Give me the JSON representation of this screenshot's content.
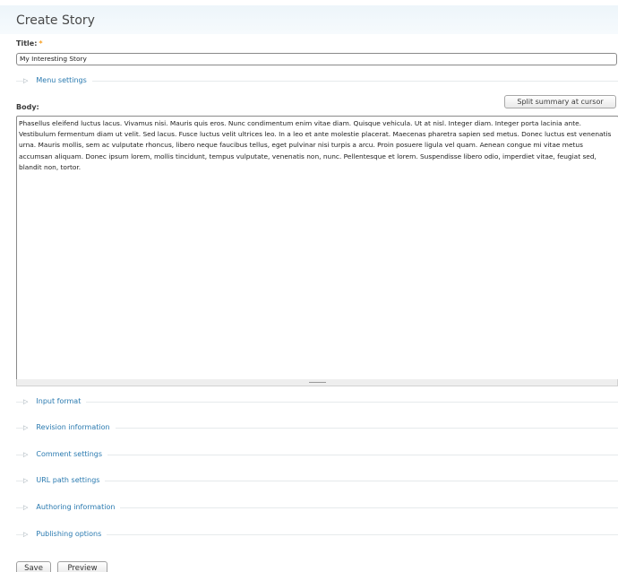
{
  "header": {
    "title": "Create Story"
  },
  "title_field": {
    "label": "Title:",
    "required_mark": "*",
    "value": "My Interesting Story"
  },
  "menu_settings": {
    "label": "Menu settings"
  },
  "body_field": {
    "label": "Body:",
    "split_button": "Split summary at cursor",
    "value": "Phasellus eleifend luctus lacus. Vivamus nisi. Mauris quis eros. Nunc condimentum enim vitae diam. Quisque vehicula. Ut at nisl. Integer diam. Integer porta lacinia ante. Vestibulum fermentum diam ut velit. Sed lacus. Fusce luctus velit ultrices leo. In a leo et ante molestie placerat. Maecenas pharetra sapien sed metus. Donec luctus est venenatis urna. Mauris mollis, sem ac vulputate rhoncus, libero neque faucibus tellus, eget pulvinar nisi turpis a arcu. Proin posuere ligula vel quam. Aenean congue mi vitae metus accumsan aliquam. Donec ipsum lorem, mollis tincidunt, tempus vulputate, venenatis non, nunc. Pellentesque et lorem. Suspendisse libero odio, imperdiet vitae, feugiat sed, blandit non, tortor."
  },
  "fieldsets": [
    {
      "label": "Input format"
    },
    {
      "label": "Revision information"
    },
    {
      "label": "Comment settings"
    },
    {
      "label": "URL path settings"
    },
    {
      "label": "Authoring information"
    },
    {
      "label": "Publishing options"
    }
  ],
  "actions": {
    "save": "Save",
    "preview": "Preview"
  },
  "icons": {
    "collapsed_arrow": "▷"
  }
}
